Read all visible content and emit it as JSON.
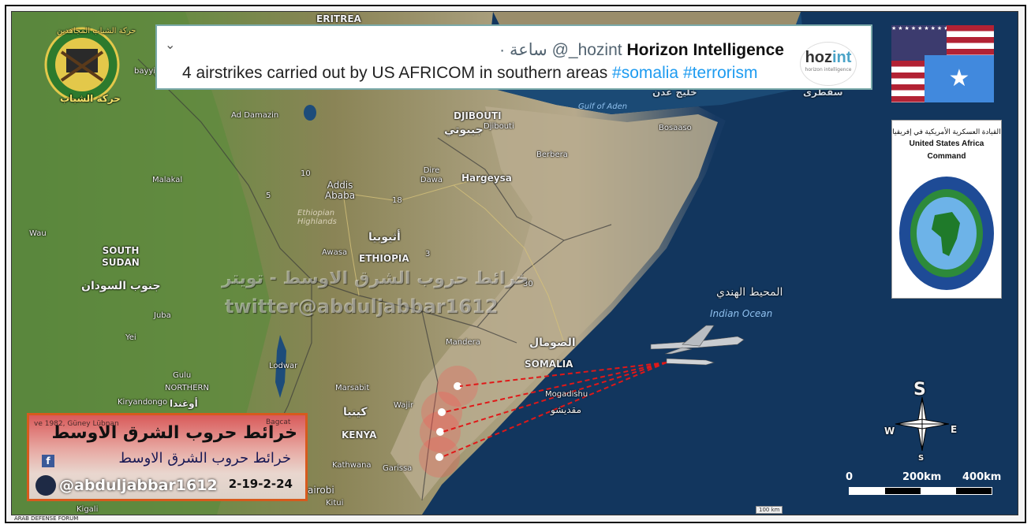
{
  "tweet": {
    "author_name": "Horizon Intelligence",
    "handle": "@_hozint",
    "time_ago": "· ساعة",
    "text_main": "4 airstrikes carried out by US AFRICOM in southern areas",
    "hashtag1": "#somalia",
    "hashtag2": "#terrorism",
    "logo_text_a": "hoz",
    "logo_text_b": "int",
    "logo_sub": "horizon intelligence"
  },
  "africom": {
    "arabic_title": "القيادة العسكرية الأمريكية في إفريقيا",
    "english_title_1": "United States Africa",
    "english_title_2": "Command",
    "seal_text": "UNITED STATES AFRICA COMMAND"
  },
  "map_labels": {
    "eritrea": "ERITREA",
    "djibouti": "DJIBOUTI",
    "djibouti_ar": "جيبوتي",
    "djibouti_city": "Djibouti",
    "gulf_aden": "Gulf of Aden",
    "gulf_aden_ar": "خليج عدن",
    "socotra_ar": "سقطرى",
    "bosaaso": "Bosaaso",
    "berbera": "Berbera",
    "hargeysa": "Hargeysa",
    "dire_dawa": "Dire Dawa",
    "addis": "Addis Ababa",
    "ethiopian_highlands": "Ethiopian Highlands",
    "ethiopia": "ETHIOPIA",
    "ethiopia_ar": "أثيوبيا",
    "awasa": "Awasa",
    "ad_damazin": "Ad Damazin",
    "malakal": "Malakal",
    "wau": "Wau",
    "south_sudan": "SOUTH SUDAN",
    "south_sudan_ar": "جنوب السودان",
    "juba": "Juba",
    "yei": "Yei",
    "gulu": "Gulu",
    "northern": "NORTHERN",
    "kiryandongo": "Kiryandongo",
    "uganda_ar": "أوغندا",
    "lodwar": "Lodwar",
    "marsabit": "Marsabit",
    "wajir": "Wajir",
    "kenya": "KENYA",
    "kenya_ar": "كينيا",
    "garissa": "Garissa",
    "kathwana": "Kathwana",
    "nairobi": "airobi",
    "kitui": "Kitui",
    "kigali": "Kigali",
    "mandera": "Mandera",
    "somalia": "SOMALIA",
    "somalia_ar": "الصومال",
    "mogadishu": "Mogadishu",
    "mogadishu_ar": "مقديشو",
    "indian_ocean": "Indian Ocean",
    "indian_ocean_ar": "المحيط الهندي",
    "bayyid": "bayyid",
    "road_5": "5",
    "road_10": "10",
    "road_18": "18",
    "road_30": "30",
    "road_3": "3"
  },
  "watermark": {
    "arabic": "خرائط حروب الشرق الاوسط - تويتر",
    "twitter": "twitter@abduljabbar1612"
  },
  "banner": {
    "arabic_1": "خرائط حروب الشرق الاوسط",
    "arabic_2": "خرائط حروب الشرق الاوسط",
    "handle": "@abduljabbar1612",
    "date": "2-19-2-24",
    "background_text": "ve 1982, Güney Lübnan",
    "bagcat": "Bagcat"
  },
  "jihad_logo": {
    "top_text": "حركة الشباب المجاهدين",
    "bottom_text": "حركة الشباب"
  },
  "compass": {
    "n": "S",
    "s": "S",
    "e": "E",
    "w": "W"
  },
  "scale": {
    "zero": "0",
    "mid": "200km",
    "end": "400km",
    "mini": "100 km"
  },
  "footer": {
    "credit": "ARAB DEFENSE FORUM"
  },
  "strikes_count": 4,
  "colors": {
    "strike_line": "#e01818",
    "tweet_border": "#7aa9a9",
    "hashtag": "#1d9bf0",
    "ocean": "#0e2f56"
  }
}
